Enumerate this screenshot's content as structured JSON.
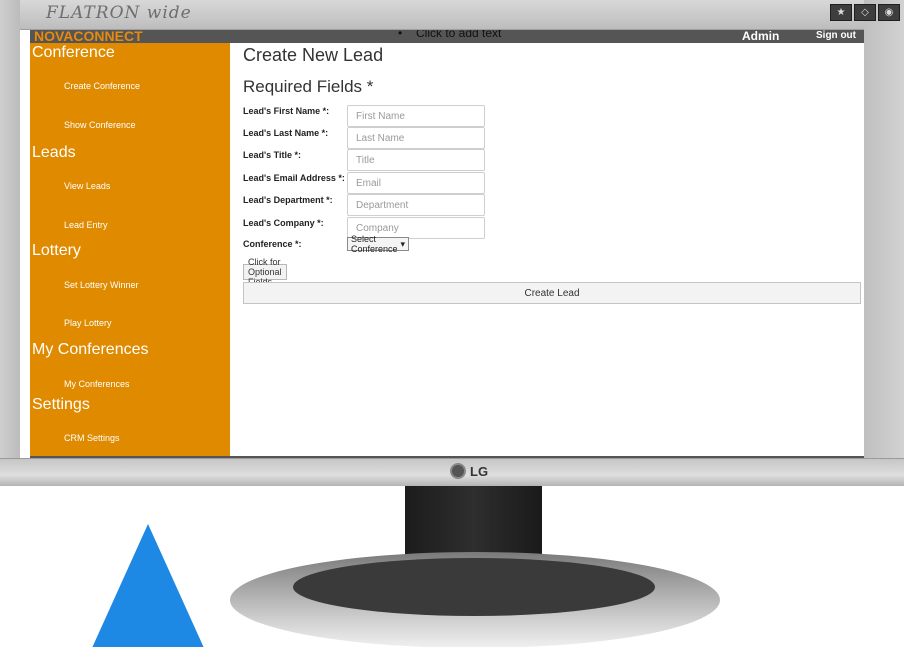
{
  "monitor": {
    "brand_top": "FLATRON wide",
    "brand_bottom": "LG",
    "accent_color": "#e08a00"
  },
  "topbar": {
    "brand": "NOVACONNECT",
    "hint": "Click to add text",
    "user": "Admin",
    "signout": "Sign out"
  },
  "sidebar": {
    "sections": [
      {
        "header": "Conference",
        "links": [
          "Create Conference",
          "Show Conference"
        ]
      },
      {
        "header": "Leads",
        "links": [
          "View Leads",
          "Lead Entry"
        ]
      },
      {
        "header": "Lottery",
        "links": [
          "Set Lottery Winner",
          "Play Lottery"
        ]
      },
      {
        "header": "My Conferences",
        "links": [
          "My Conferences"
        ]
      },
      {
        "header": "Settings",
        "links": [
          "CRM Settings"
        ]
      }
    ]
  },
  "main": {
    "title": "Create New Lead",
    "section_title": "Required Fields *",
    "fields": [
      {
        "label": "Lead's First Name *:",
        "placeholder": "First Name"
      },
      {
        "label": "Lead's Last Name *:",
        "placeholder": "Last Name"
      },
      {
        "label": "Lead's Title *:",
        "placeholder": "Title"
      },
      {
        "label": "Lead's Email Address *:",
        "placeholder": "Email"
      },
      {
        "label": "Lead's Department *:",
        "placeholder": "Department"
      },
      {
        "label": "Lead's Company *:",
        "placeholder": "Company"
      }
    ],
    "conference_label": "Conference *:",
    "conference_select": "Select Conference",
    "optional_button": "Click for Optional Fields",
    "create_button": "Create Lead"
  }
}
